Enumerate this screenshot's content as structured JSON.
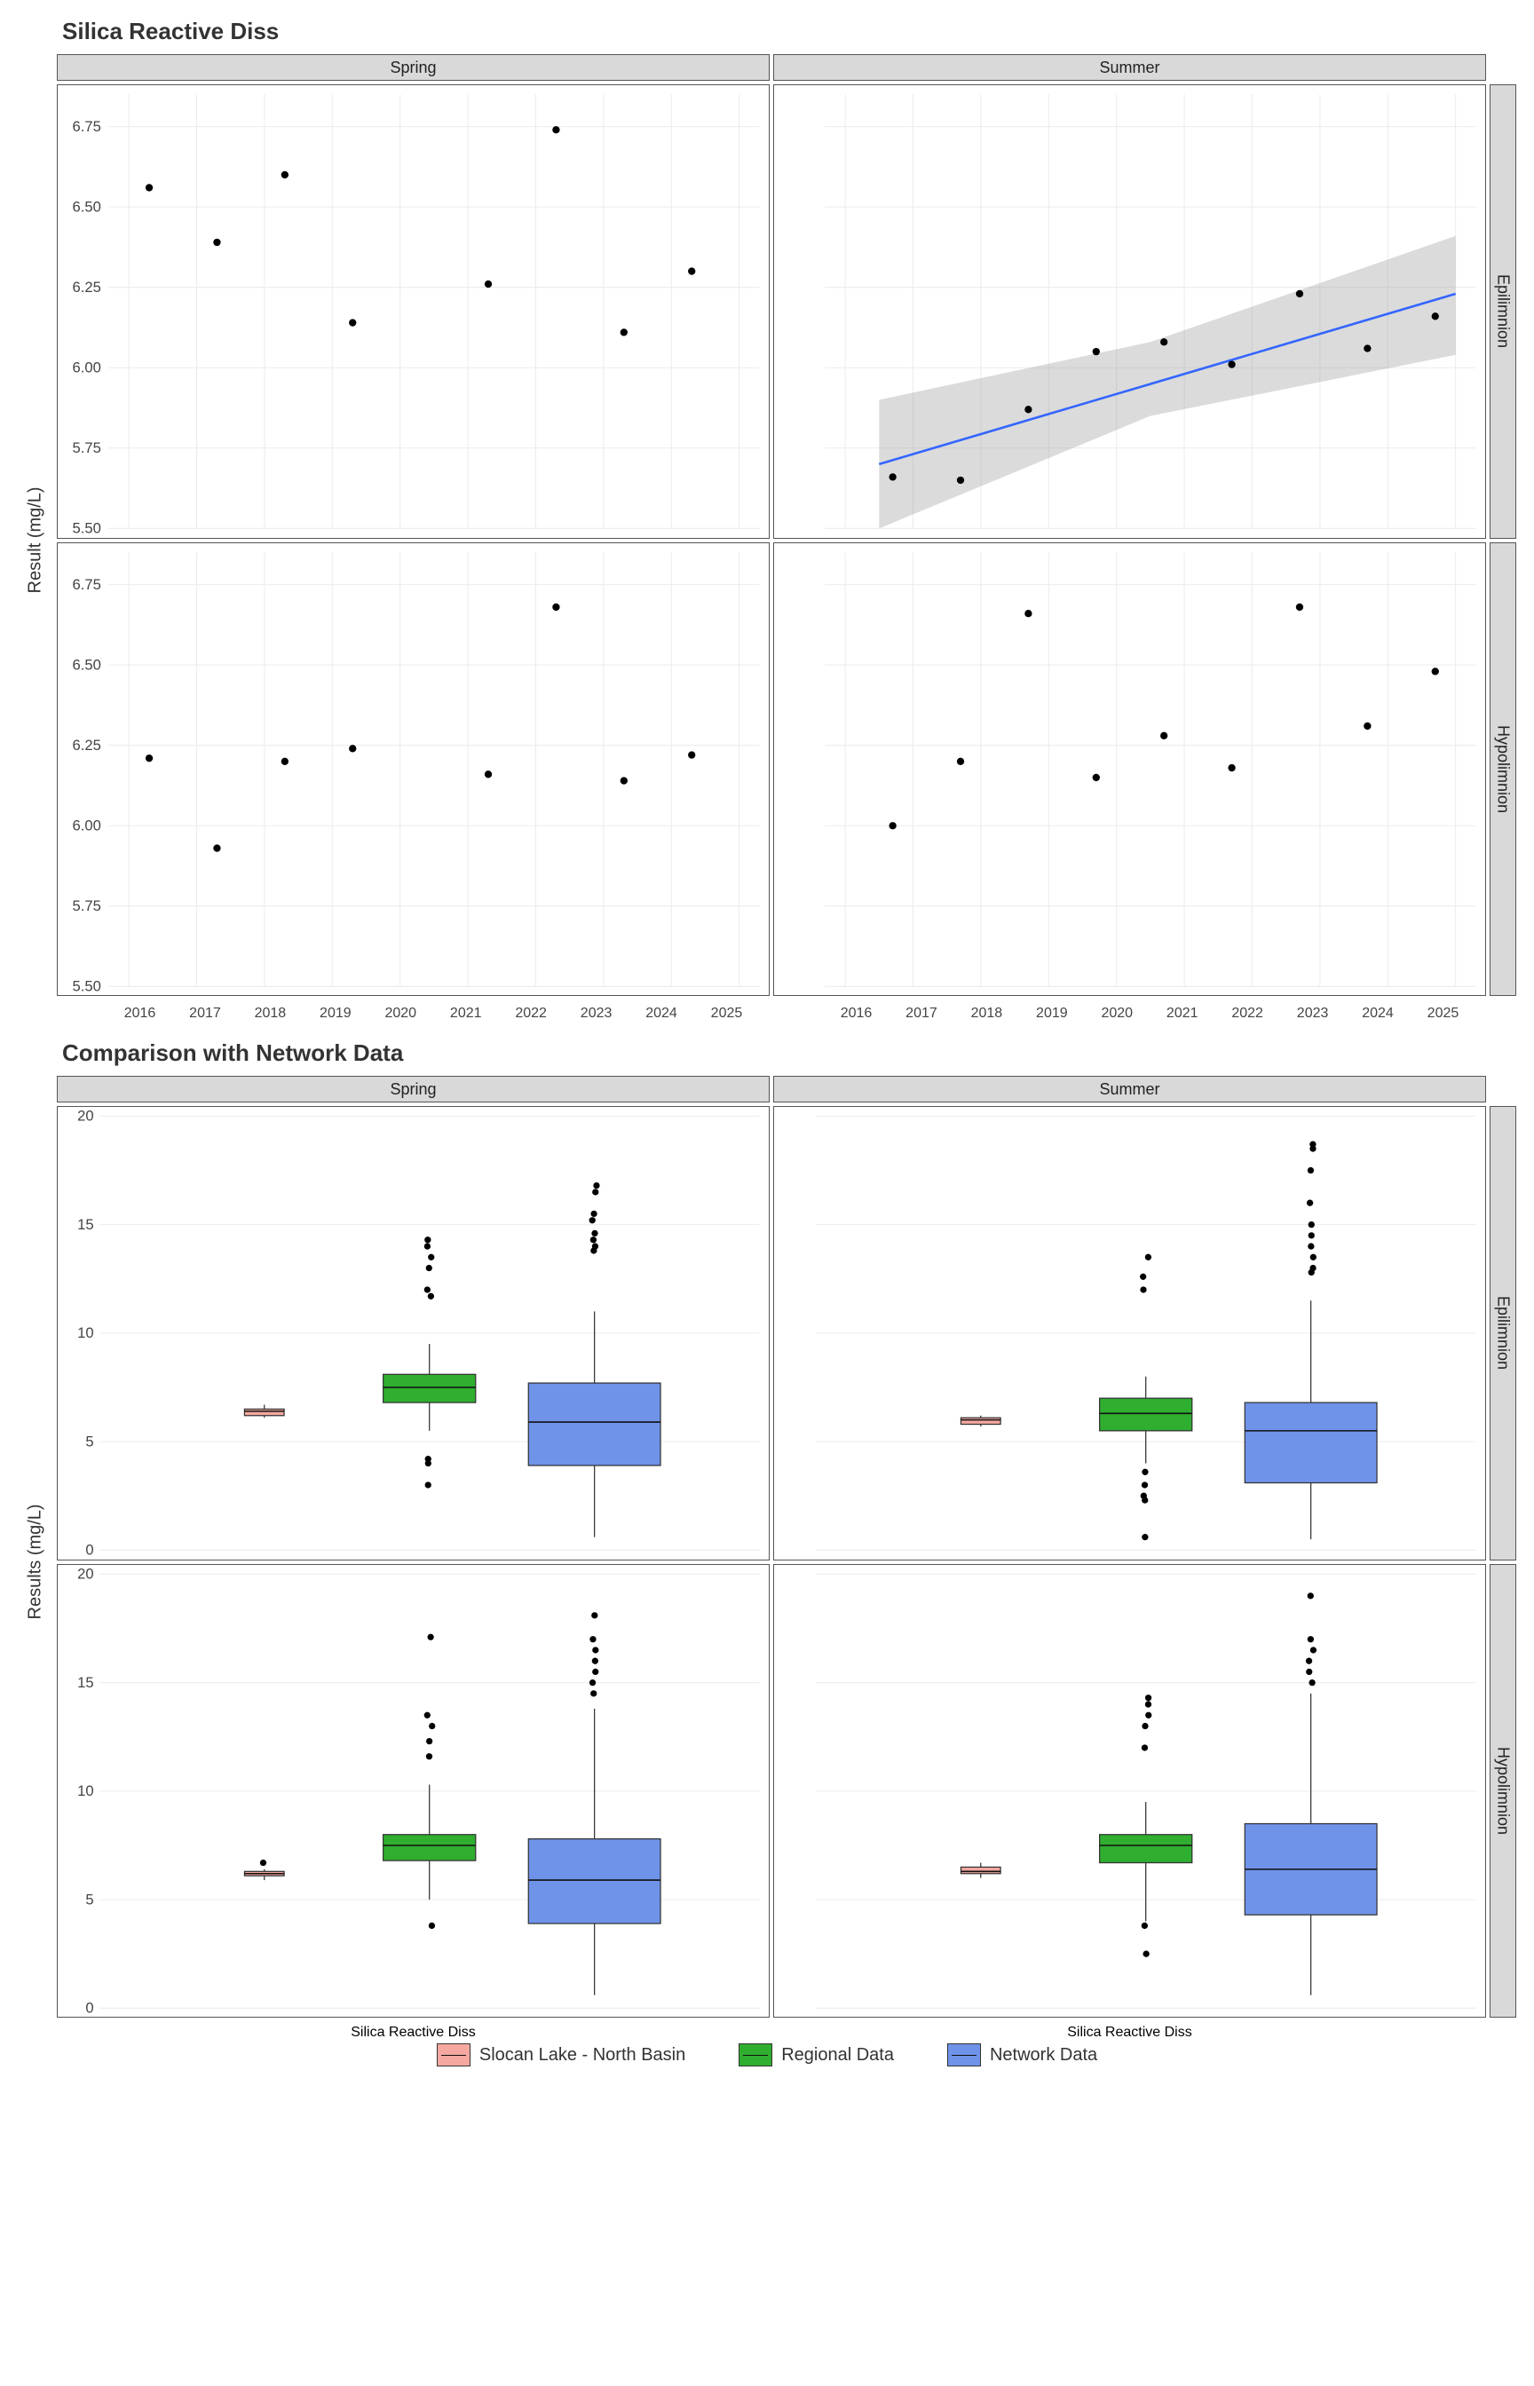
{
  "chart_data": [
    {
      "type": "scatter",
      "title": "Silica Reactive Diss",
      "ylabel": "Result (mg/L)",
      "xlabel": "",
      "facet_cols": [
        "Spring",
        "Summer"
      ],
      "facet_rows": [
        "Epilimnion",
        "Hypolimnion"
      ],
      "x_ticks": [
        2016,
        2017,
        2018,
        2019,
        2020,
        2021,
        2022,
        2023,
        2024,
        2025
      ],
      "y_ticks": [
        5.5,
        5.75,
        6.0,
        6.25,
        6.5,
        6.75
      ],
      "ylim": [
        5.5,
        6.85
      ],
      "panels": {
        "Spring_Epilimnion": {
          "points": [
            {
              "x": 2016.3,
              "y": 6.56
            },
            {
              "x": 2017.3,
              "y": 6.39
            },
            {
              "x": 2018.3,
              "y": 6.6
            },
            {
              "x": 2019.3,
              "y": 6.14
            },
            {
              "x": 2021.3,
              "y": 6.26
            },
            {
              "x": 2022.3,
              "y": 6.74
            },
            {
              "x": 2023.3,
              "y": 6.11
            },
            {
              "x": 2024.3,
              "y": 6.3
            }
          ],
          "trend": null
        },
        "Summer_Epilimnion": {
          "points": [
            {
              "x": 2016.7,
              "y": 5.66
            },
            {
              "x": 2017.7,
              "y": 5.65
            },
            {
              "x": 2018.7,
              "y": 5.87
            },
            {
              "x": 2019.7,
              "y": 6.05
            },
            {
              "x": 2020.7,
              "y": 6.08
            },
            {
              "x": 2021.7,
              "y": 6.01
            },
            {
              "x": 2022.7,
              "y": 6.23
            },
            {
              "x": 2023.7,
              "y": 6.06
            },
            {
              "x": 2024.7,
              "y": 6.16
            }
          ],
          "trend": {
            "x0": 2016.5,
            "y0": 5.7,
            "x1": 2025.0,
            "y1": 6.23,
            "band": [
              {
                "x": 2016.5,
                "hi": 5.9,
                "lo": 5.5
              },
              {
                "x": 2020.5,
                "hi": 6.08,
                "lo": 5.85
              },
              {
                "x": 2025.0,
                "hi": 6.41,
                "lo": 6.04
              }
            ]
          }
        },
        "Spring_Hypolimnion": {
          "points": [
            {
              "x": 2016.3,
              "y": 6.21
            },
            {
              "x": 2017.3,
              "y": 5.93
            },
            {
              "x": 2018.3,
              "y": 6.2
            },
            {
              "x": 2019.3,
              "y": 6.24
            },
            {
              "x": 2021.3,
              "y": 6.16
            },
            {
              "x": 2022.3,
              "y": 6.68
            },
            {
              "x": 2023.3,
              "y": 6.14
            },
            {
              "x": 2024.3,
              "y": 6.22
            }
          ],
          "trend": null
        },
        "Summer_Hypolimnion": {
          "points": [
            {
              "x": 2016.7,
              "y": 6.0
            },
            {
              "x": 2017.7,
              "y": 6.2
            },
            {
              "x": 2018.7,
              "y": 6.66
            },
            {
              "x": 2019.7,
              "y": 6.15
            },
            {
              "x": 2020.7,
              "y": 6.28
            },
            {
              "x": 2021.7,
              "y": 6.18
            },
            {
              "x": 2022.7,
              "y": 6.68
            },
            {
              "x": 2023.7,
              "y": 6.31
            },
            {
              "x": 2024.7,
              "y": 6.48
            }
          ],
          "trend": null
        }
      }
    },
    {
      "type": "box",
      "title": "Comparison with Network Data",
      "ylabel": "Results (mg/L)",
      "xlabel": "Silica Reactive Diss",
      "facet_cols": [
        "Spring",
        "Summer"
      ],
      "facet_rows": [
        "Epilimnion",
        "Hypolimnion"
      ],
      "y_ticks": [
        0,
        5,
        10,
        15,
        20
      ],
      "ylim": [
        0,
        20
      ],
      "legend": [
        {
          "name": "Slocan Lake - North Basin",
          "color": "#f4a8a0"
        },
        {
          "name": "Regional Data",
          "color": "#2fae2f"
        },
        {
          "name": "Network Data",
          "color": "#6f93e8"
        }
      ],
      "panels": {
        "Spring_Epilimnion": {
          "boxes": [
            {
              "series": "Slocan Lake - North Basin",
              "min": 6.1,
              "q1": 6.2,
              "med": 6.4,
              "q3": 6.5,
              "max": 6.7,
              "outliers": []
            },
            {
              "series": "Regional Data",
              "min": 5.5,
              "q1": 6.8,
              "med": 7.5,
              "q3": 8.1,
              "max": 9.5,
              "outliers": [
                3.0,
                4.0,
                4.2,
                11.7,
                12.0,
                13.0,
                13.5,
                14.0,
                14.3
              ]
            },
            {
              "series": "Network Data",
              "min": 0.6,
              "q1": 3.9,
              "med": 5.9,
              "q3": 7.7,
              "max": 11.0,
              "outliers": [
                13.8,
                14.0,
                14.3,
                14.6,
                15.2,
                15.5,
                16.5,
                16.8
              ]
            }
          ]
        },
        "Summer_Epilimnion": {
          "boxes": [
            {
              "series": "Slocan Lake - North Basin",
              "min": 5.7,
              "q1": 5.8,
              "med": 6.0,
              "q3": 6.1,
              "max": 6.2,
              "outliers": []
            },
            {
              "series": "Regional Data",
              "min": 4.0,
              "q1": 5.5,
              "med": 6.3,
              "q3": 7.0,
              "max": 8.0,
              "outliers": [
                0.6,
                2.3,
                2.5,
                3.0,
                3.6,
                12.0,
                12.6,
                13.5
              ]
            },
            {
              "series": "Network Data",
              "min": 0.5,
              "q1": 3.1,
              "med": 5.5,
              "q3": 6.8,
              "max": 11.5,
              "outliers": [
                12.8,
                13.0,
                13.5,
                14.0,
                14.5,
                15.0,
                16.0,
                17.5,
                18.5,
                18.7
              ]
            }
          ]
        },
        "Spring_Hypolimnion": {
          "boxes": [
            {
              "series": "Slocan Lake - North Basin",
              "min": 5.9,
              "q1": 6.1,
              "med": 6.2,
              "q3": 6.3,
              "max": 6.4,
              "outliers": [
                6.7
              ]
            },
            {
              "series": "Regional Data",
              "min": 5.0,
              "q1": 6.8,
              "med": 7.5,
              "q3": 8.0,
              "max": 10.3,
              "outliers": [
                3.8,
                11.6,
                12.3,
                13.0,
                13.5,
                17.1
              ]
            },
            {
              "series": "Network Data",
              "min": 0.6,
              "q1": 3.9,
              "med": 5.9,
              "q3": 7.8,
              "max": 13.8,
              "outliers": [
                14.5,
                15.0,
                15.5,
                16.0,
                16.5,
                17.0,
                18.1
              ]
            }
          ]
        },
        "Summer_Hypolimnion": {
          "boxes": [
            {
              "series": "Slocan Lake - North Basin",
              "min": 6.0,
              "q1": 6.2,
              "med": 6.3,
              "q3": 6.5,
              "max": 6.7,
              "outliers": []
            },
            {
              "series": "Regional Data",
              "min": 4.0,
              "q1": 6.7,
              "med": 7.5,
              "q3": 8.0,
              "max": 9.5,
              "outliers": [
                2.5,
                3.8,
                12.0,
                13.0,
                13.5,
                14.0,
                14.3
              ]
            },
            {
              "series": "Network Data",
              "min": 0.6,
              "q1": 4.3,
              "med": 6.4,
              "q3": 8.5,
              "max": 14.5,
              "outliers": [
                15.0,
                15.5,
                16.0,
                16.5,
                17.0,
                19.0
              ]
            }
          ]
        }
      }
    }
  ]
}
